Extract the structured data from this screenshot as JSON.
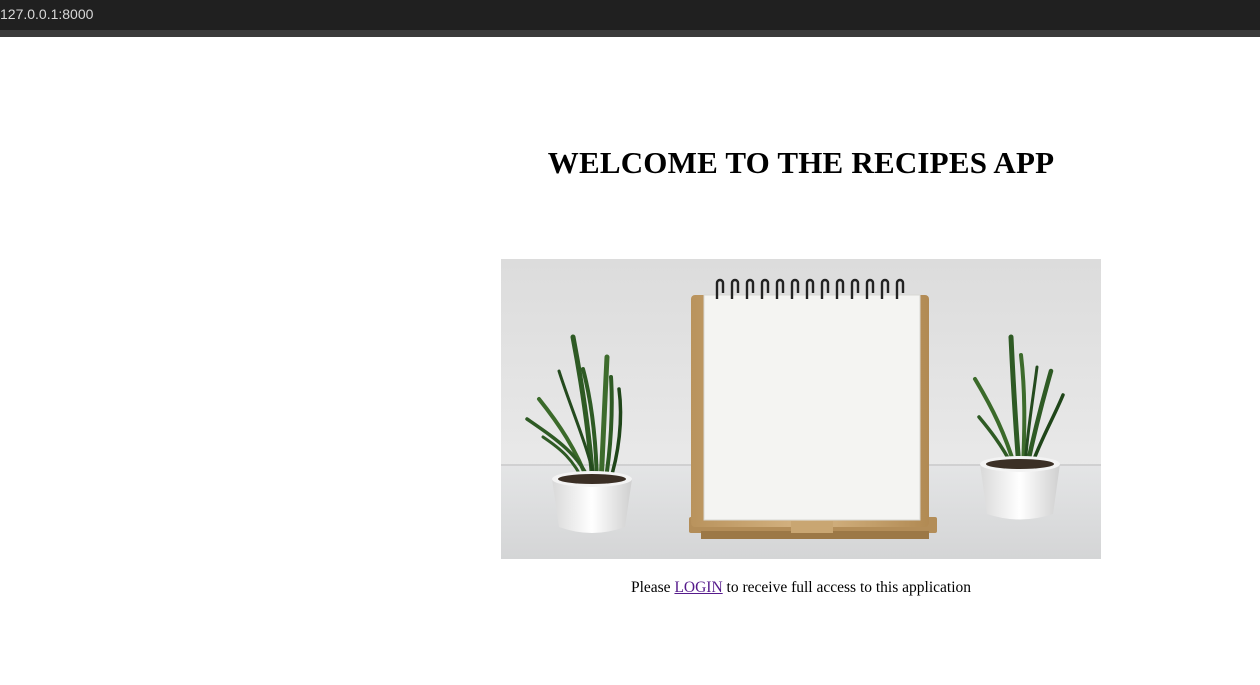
{
  "browser": {
    "url": "127.0.0.1:8000"
  },
  "page": {
    "heading": "WELCOME TO THE RECIPES APP",
    "login_prefix": "Please",
    "login_link": "LOGIN",
    "login_suffix": "to receive full access to this application",
    "hero_image": "notebook-with-plants"
  },
  "colors": {
    "urlbar_bg": "#202020",
    "link_visited": "#551a8b"
  }
}
